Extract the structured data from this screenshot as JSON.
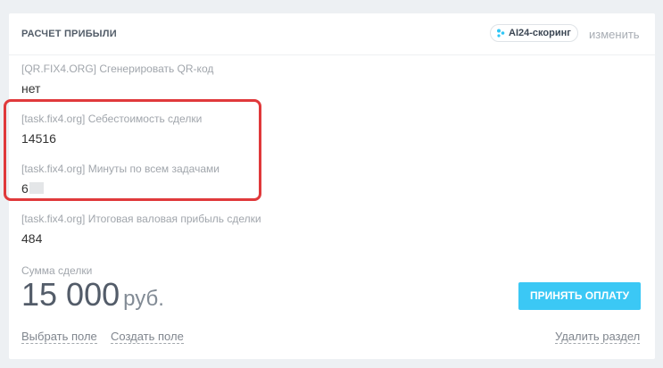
{
  "card": {
    "title": "РАСЧЕТ ПРИБЫЛИ",
    "ai_badge": "AI24-скоринг",
    "change_link": "изменить"
  },
  "fields": [
    {
      "label": "[QR.FIX4.ORG] Сгенерировать QR-код",
      "value": "нет"
    },
    {
      "label": "[task.fix4.org] Себестоимость сделки",
      "value": "14516"
    },
    {
      "label": "[task.fix4.org] Минуты по всем задачами",
      "value": "6"
    },
    {
      "label": "[task.fix4.org] Итоговая валовая прибыль сделки",
      "value": "484"
    }
  ],
  "deal_sum": {
    "label": "Сумма сделки",
    "amount": "15 000",
    "currency": "руб."
  },
  "buttons": {
    "accept_payment": "ПРИНЯТЬ ОПЛАТУ"
  },
  "footer": {
    "select_field": "Выбрать поле",
    "create_field": "Создать поле",
    "delete_section": "Удалить раздел"
  },
  "colors": {
    "accent_button": "#3bc8f5",
    "highlight_border": "#e0393b",
    "ai_icon": "#2fc6f6"
  }
}
